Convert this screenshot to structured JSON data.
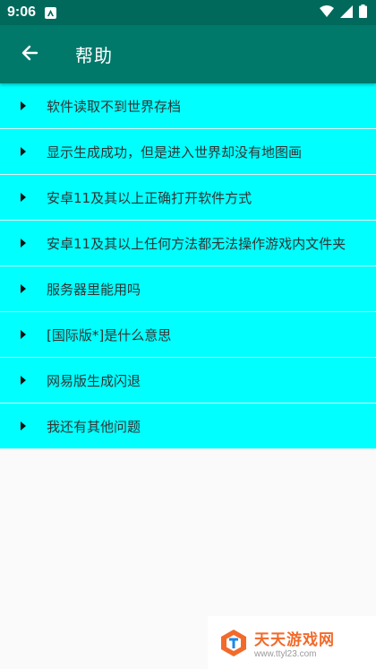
{
  "status_bar": {
    "time": "9:06"
  },
  "app_bar": {
    "title": "帮助",
    "back_icon": "arrow-left-icon"
  },
  "help_items": [
    {
      "label": "软件读取不到世界存档"
    },
    {
      "label": "显示生成成功，但是进入世界却没有地图画"
    },
    {
      "label": "安卓11及其以上正确打开软件方式"
    },
    {
      "label": "安卓11及其以上任何方法都无法操作游戏内文件夹"
    },
    {
      "label": "服务器里能用吗"
    },
    {
      "label": "[国际版*]是什么意思"
    },
    {
      "label": "网易版生成闪退"
    },
    {
      "label": "我还有其他问题"
    }
  ],
  "watermark": {
    "title": "天天游戏网",
    "url": "www.ttyl23.com"
  },
  "colors": {
    "status_bar": "#00695c",
    "app_bar": "#00796b",
    "item_bg": "#00ffff",
    "watermark": "#f26a2a"
  }
}
